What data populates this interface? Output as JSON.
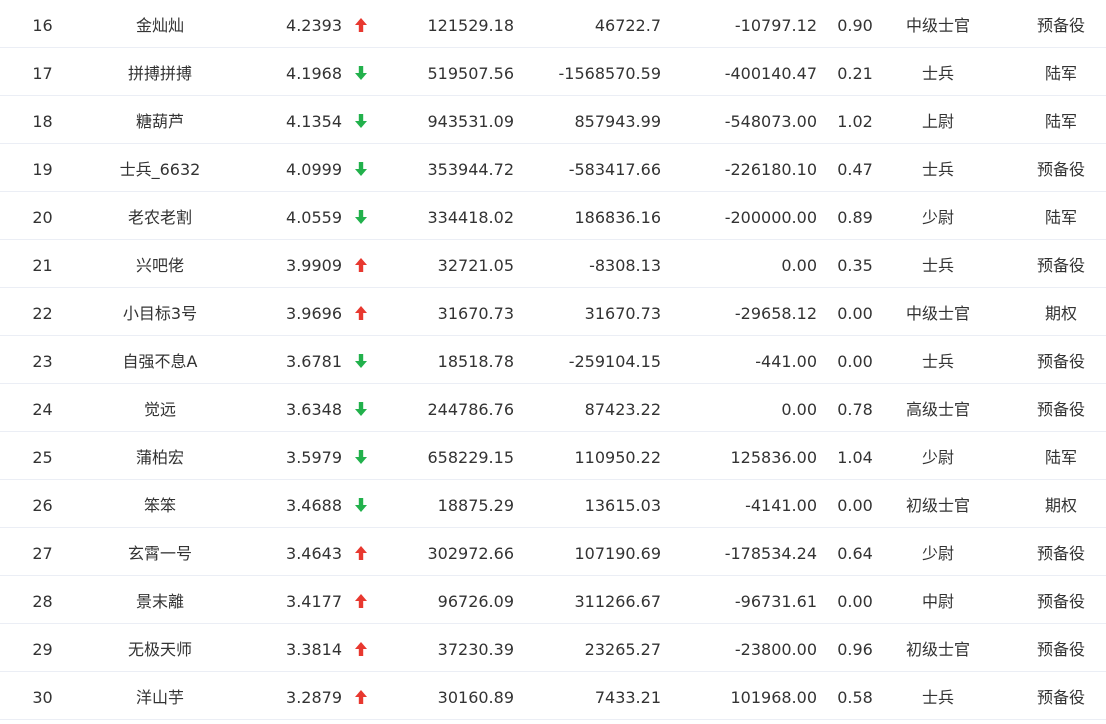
{
  "colors": {
    "up": "#e8382f",
    "down": "#22b14c",
    "text": "#333333",
    "divider": "#ebeef5"
  },
  "rows": [
    {
      "rank": "16",
      "name": "金灿灿",
      "score": "4.2393",
      "trend": "up",
      "v1": "121529.18",
      "v2": "46722.7",
      "v3": "-10797.12",
      "ratio": "0.90",
      "level": "中级士官",
      "category": "预备役"
    },
    {
      "rank": "17",
      "name": "拼搏拼搏",
      "score": "4.1968",
      "trend": "down",
      "v1": "519507.56",
      "v2": "-1568570.59",
      "v3": "-400140.47",
      "ratio": "0.21",
      "level": "士兵",
      "category": "陆军"
    },
    {
      "rank": "18",
      "name": "糖葫芦",
      "score": "4.1354",
      "trend": "down",
      "v1": "943531.09",
      "v2": "857943.99",
      "v3": "-548073.00",
      "ratio": "1.02",
      "level": "上尉",
      "category": "陆军"
    },
    {
      "rank": "19",
      "name": "士兵_6632",
      "score": "4.0999",
      "trend": "down",
      "v1": "353944.72",
      "v2": "-583417.66",
      "v3": "-226180.10",
      "ratio": "0.47",
      "level": "士兵",
      "category": "预备役"
    },
    {
      "rank": "20",
      "name": "老农老割",
      "score": "4.0559",
      "trend": "down",
      "v1": "334418.02",
      "v2": "186836.16",
      "v3": "-200000.00",
      "ratio": "0.89",
      "level": "少尉",
      "category": "陆军"
    },
    {
      "rank": "21",
      "name": "兴吧佬",
      "score": "3.9909",
      "trend": "up",
      "v1": "32721.05",
      "v2": "-8308.13",
      "v3": "0.00",
      "ratio": "0.35",
      "level": "士兵",
      "category": "预备役"
    },
    {
      "rank": "22",
      "name": "小目标3号",
      "score": "3.9696",
      "trend": "up",
      "v1": "31670.73",
      "v2": "31670.73",
      "v3": "-29658.12",
      "ratio": "0.00",
      "level": "中级士官",
      "category": "期权"
    },
    {
      "rank": "23",
      "name": "自强不息A",
      "score": "3.6781",
      "trend": "down",
      "v1": "18518.78",
      "v2": "-259104.15",
      "v3": "-441.00",
      "ratio": "0.00",
      "level": "士兵",
      "category": "预备役"
    },
    {
      "rank": "24",
      "name": "觉远",
      "score": "3.6348",
      "trend": "down",
      "v1": "244786.76",
      "v2": "87423.22",
      "v3": "0.00",
      "ratio": "0.78",
      "level": "高级士官",
      "category": "预备役"
    },
    {
      "rank": "25",
      "name": "蒲柏宏",
      "score": "3.5979",
      "trend": "down",
      "v1": "658229.15",
      "v2": "110950.22",
      "v3": "125836.00",
      "ratio": "1.04",
      "level": "少尉",
      "category": "陆军"
    },
    {
      "rank": "26",
      "name": "笨笨",
      "score": "3.4688",
      "trend": "down",
      "v1": "18875.29",
      "v2": "13615.03",
      "v3": "-4141.00",
      "ratio": "0.00",
      "level": "初级士官",
      "category": "期权"
    },
    {
      "rank": "27",
      "name": "玄霄一号",
      "score": "3.4643",
      "trend": "up",
      "v1": "302972.66",
      "v2": "107190.69",
      "v3": "-178534.24",
      "ratio": "0.64",
      "level": "少尉",
      "category": "预备役"
    },
    {
      "rank": "28",
      "name": "景末離",
      "score": "3.4177",
      "trend": "up",
      "v1": "96726.09",
      "v2": "311266.67",
      "v3": "-96731.61",
      "ratio": "0.00",
      "level": "中尉",
      "category": "预备役"
    },
    {
      "rank": "29",
      "name": "无极天师",
      "score": "3.3814",
      "trend": "up",
      "v1": "37230.39",
      "v2": "23265.27",
      "v3": "-23800.00",
      "ratio": "0.96",
      "level": "初级士官",
      "category": "预备役"
    },
    {
      "rank": "30",
      "name": "洋山芋",
      "score": "3.2879",
      "trend": "up",
      "v1": "30160.89",
      "v2": "7433.21",
      "v3": "101968.00",
      "ratio": "0.58",
      "level": "士兵",
      "category": "预备役"
    }
  ]
}
